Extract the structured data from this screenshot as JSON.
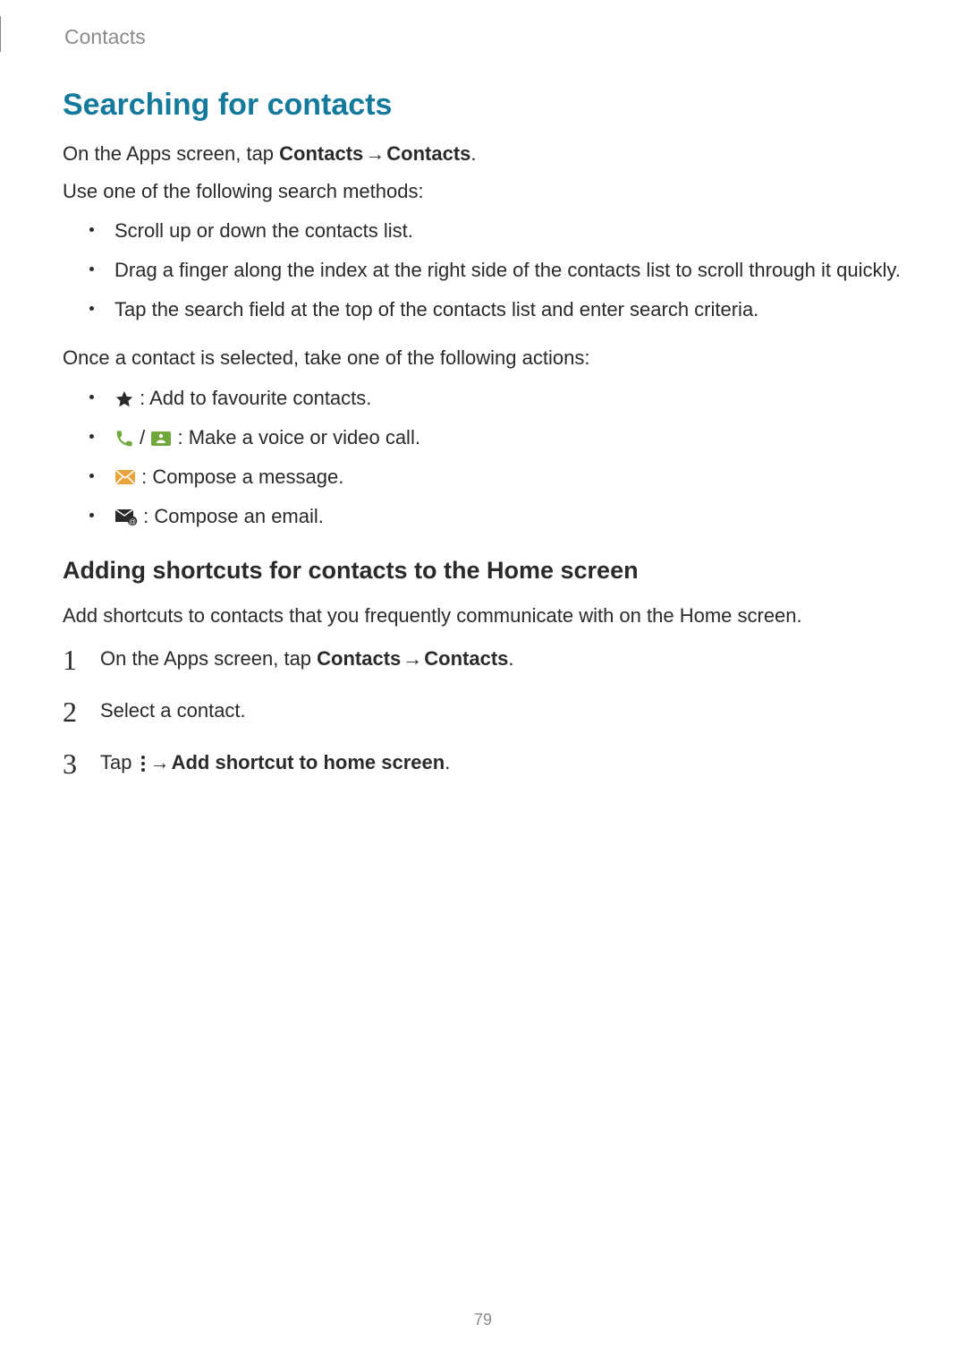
{
  "header": {
    "section": "Contacts"
  },
  "title": "Searching for contacts",
  "intro": {
    "prefix": "On the Apps screen, tap ",
    "bold1": "Contacts",
    "arrow": " → ",
    "bold2": "Contacts",
    "suffix": "."
  },
  "intro2": "Use one of the following search methods:",
  "search_methods": [
    "Scroll up or down the contacts list.",
    "Drag a finger along the index at the right side of the contacts list to scroll through it quickly.",
    "Tap the search field at the top of the contacts list and enter search criteria."
  ],
  "once_selected": "Once a contact is selected, take one of the following actions:",
  "actions": {
    "fav": " : Add to favourite contacts.",
    "call_sep": " / ",
    "call": " : Make a voice or video call.",
    "msg": " : Compose a message.",
    "email": " : Compose an email."
  },
  "subheading": "Adding shortcuts for contacts to the Home screen",
  "sub_intro": "Add shortcuts to contacts that you frequently communicate with on the Home screen.",
  "steps": {
    "s1": {
      "num": "1",
      "prefix": "On the Apps screen, tap ",
      "bold1": "Contacts",
      "arrow": " → ",
      "bold2": "Contacts",
      "suffix": "."
    },
    "s2": {
      "num": "2",
      "text": "Select a contact."
    },
    "s3": {
      "num": "3",
      "prefix": "Tap ",
      "arrow": " → ",
      "bold": "Add shortcut to home screen",
      "suffix": "."
    }
  },
  "page_number": "79"
}
